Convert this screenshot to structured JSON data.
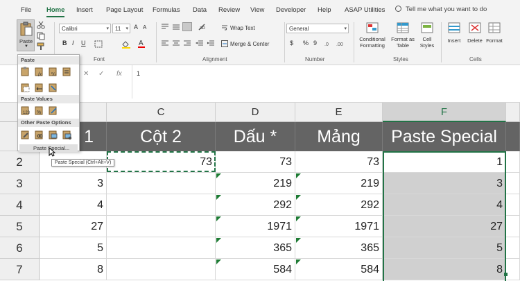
{
  "menu": {
    "tabs": [
      "File",
      "Home",
      "Insert",
      "Page Layout",
      "Formulas",
      "Data",
      "Review",
      "View",
      "Developer",
      "Help",
      "ASAP Utilities"
    ],
    "active_tab": "Home",
    "tell_me": "Tell me what you want to do"
  },
  "ribbon": {
    "paste_label": "Paste",
    "font_name": "Calibri",
    "font_size": "11",
    "grow_font": "A",
    "shrink_font": "A",
    "bold": "B",
    "italic": "I",
    "underline": "U",
    "wrap_text": "Wrap Text",
    "merge_center": "Merge & Center",
    "number_format": "General",
    "currency": "$",
    "percent": "%",
    "comma": "9",
    "conditional_formatting": "Conditional Formatting",
    "format_as_table": "Format as Table",
    "cell_styles": "Cell Styles",
    "insert": "Insert",
    "delete": "Delete",
    "format": "Format",
    "groups": {
      "font": "Font",
      "alignment": "Alignment",
      "number": "Number",
      "styles": "Styles",
      "cells": "Cells"
    }
  },
  "formula_bar": {
    "fx": "fx",
    "value": "1"
  },
  "paste_menu": {
    "section_paste": "Paste",
    "section_paste_values": "Paste Values",
    "section_other": "Other Paste Options",
    "paste_special": "Paste Special...",
    "tooltip": "Paste Special (Ctrl+Alt+V)"
  },
  "grid": {
    "columns": [
      "C",
      "D",
      "E",
      "F"
    ],
    "selected_column": "F",
    "header_row": {
      "b_fragment": "1",
      "c": "Cột 2",
      "d": "Dấu *",
      "e": "Mảng",
      "f": "Paste Special"
    },
    "rows": [
      {
        "num": "2",
        "b": "",
        "c": "73",
        "d": "73",
        "e": "73",
        "f": "1"
      },
      {
        "num": "3",
        "b": "3",
        "c": "",
        "d": "219",
        "e": "219",
        "f": "3"
      },
      {
        "num": "4",
        "b": "4",
        "c": "",
        "d": "292",
        "e": "292",
        "f": "4"
      },
      {
        "num": "5",
        "b": "27",
        "c": "",
        "d": "1971",
        "e": "1971",
        "f": "27"
      },
      {
        "num": "6",
        "b": "5",
        "c": "",
        "d": "365",
        "e": "365",
        "f": "5"
      },
      {
        "num": "7",
        "b": "8",
        "c": "",
        "d": "584",
        "e": "584",
        "f": "8"
      }
    ]
  },
  "colors": {
    "accent": "#217346",
    "header_row_bg": "#646464",
    "selection_bg": "#d0d0d0"
  }
}
